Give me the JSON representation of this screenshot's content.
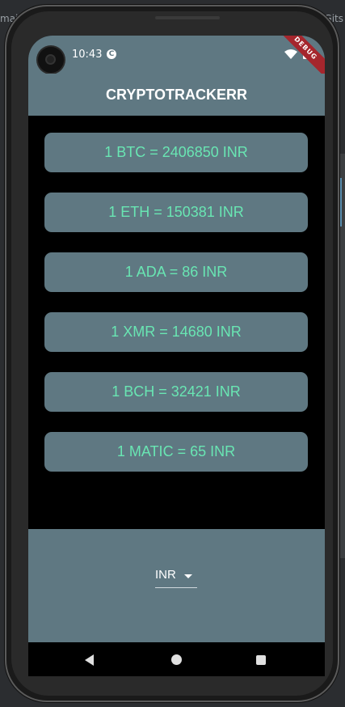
{
  "ide": {
    "left_text": "mai",
    "right_text": "Gits"
  },
  "status_bar": {
    "time": "10:43",
    "debug_label": "DEBUG"
  },
  "app_bar": {
    "title": "CRYPTOTRACKERR"
  },
  "rates": [
    {
      "text": "1 BTC = 2406850 INR"
    },
    {
      "text": "1 ETH = 150381 INR"
    },
    {
      "text": "1 ADA = 86 INR"
    },
    {
      "text": "1 XMR = 14680 INR"
    },
    {
      "text": "1 BCH = 32421 INR"
    },
    {
      "text": "1 MATIC = 65 INR"
    }
  ],
  "currency_selector": {
    "selected": "INR"
  },
  "colors": {
    "primary": "#5f7882",
    "rate_text": "#69e6b3",
    "background": "#000000"
  },
  "icons": {
    "nav_back": "triangle-back-icon",
    "nav_home": "circle-home-icon",
    "nav_recent": "square-recents-icon"
  }
}
